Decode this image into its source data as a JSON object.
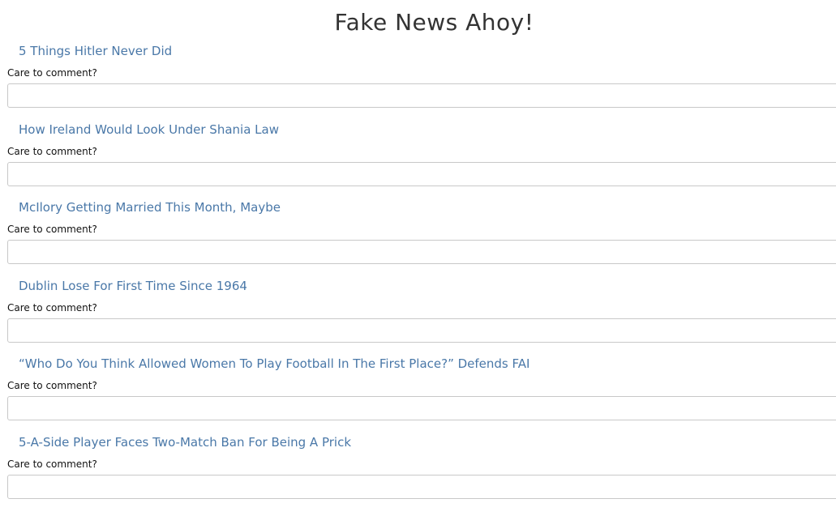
{
  "page": {
    "title": "Fake News Ahoy!"
  },
  "colors": {
    "link": "#4a78a8",
    "input_border": "#c8c8c8"
  },
  "articles": [
    {
      "title": "5 Things Hitler Never Did",
      "comment_label": "Care to comment?",
      "comment_value": ""
    },
    {
      "title": "How Ireland Would Look Under Shania Law",
      "comment_label": "Care to comment?",
      "comment_value": ""
    },
    {
      "title": "McIlory Getting Married This Month, Maybe",
      "comment_label": "Care to comment?",
      "comment_value": ""
    },
    {
      "title": "Dublin Lose For First Time Since 1964",
      "comment_label": "Care to comment?",
      "comment_value": ""
    },
    {
      "title": "“Who Do You Think Allowed Women To Play Football In The First Place?” Defends FAI",
      "comment_label": "Care to comment?",
      "comment_value": ""
    },
    {
      "title": "5-A-Side Player Faces Two-Match Ban For Being A Prick",
      "comment_label": "Care to comment?",
      "comment_value": ""
    }
  ]
}
